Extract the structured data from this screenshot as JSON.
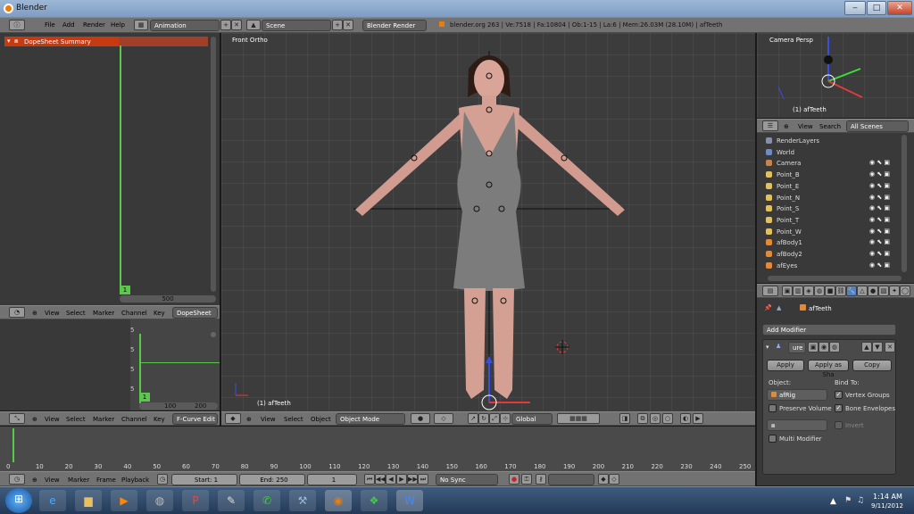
{
  "window": {
    "title": "Blender",
    "minimize": "‒",
    "maximize": "□",
    "close": "✕"
  },
  "menubar": {
    "items": [
      "File",
      "Add",
      "Render",
      "Help"
    ],
    "layout": "Animation",
    "scene": "Scene",
    "engine": "Blender Render",
    "info": "blender.org 263 | Ve:7518 | Fa:10804 | Ob:1-15 | La:6 | Mem:26.03M (28.10M) | afTeeth"
  },
  "dopesheet": {
    "summary": "DopeSheet Summary",
    "frame_marker": "1",
    "scroll_value": "500",
    "header": {
      "menus": [
        "View",
        "Select",
        "Marker",
        "Channel",
        "Key"
      ],
      "mode": "DopeSheet"
    }
  },
  "fcurve": {
    "ticks": [
      "5",
      "5",
      "5",
      "5"
    ],
    "frame_marker": "1",
    "x_labels": [
      "100",
      "200"
    ],
    "header": {
      "menus": [
        "View",
        "Select",
        "Marker",
        "Channel",
        "Key"
      ],
      "mode": "F-Curve Edit"
    }
  },
  "viewport": {
    "label": "Front Ortho",
    "object_label": "(1) afTeeth",
    "header": {
      "menus": [
        "View",
        "Select",
        "Object"
      ],
      "mode": "Object Mode",
      "orientation": "Global"
    }
  },
  "camera_view": {
    "label": "Camera Persp",
    "object_label": "(1) afTeeth"
  },
  "outliner": {
    "header": {
      "view": "View",
      "search": "Search",
      "filter": "All Scenes"
    },
    "rows": [
      {
        "label": "RenderLayers",
        "icon_color": "#8a8fa8"
      },
      {
        "label": "World",
        "icon_color": "#6b8cc9"
      },
      {
        "label": "Camera",
        "icon_color": "#c8824a"
      },
      {
        "label": "Point_B",
        "icon_color": "#e0c060"
      },
      {
        "label": "Point_E",
        "icon_color": "#e0c060"
      },
      {
        "label": "Point_N",
        "icon_color": "#e0c060"
      },
      {
        "label": "Point_S",
        "icon_color": "#e0c060"
      },
      {
        "label": "Point_T",
        "icon_color": "#e0c060"
      },
      {
        "label": "Point_W",
        "icon_color": "#e0c060"
      },
      {
        "label": "afBody1",
        "icon_color": "#e08a3a"
      },
      {
        "label": "afBody2",
        "icon_color": "#e08a3a"
      },
      {
        "label": "afEyes",
        "icon_color": "#e08a3a"
      }
    ]
  },
  "properties": {
    "object_name": "afTeeth",
    "add_modifier": "Add Modifier",
    "modifier_name": "ure",
    "apply": "Apply",
    "apply_shape": "Apply as Sha",
    "copy": "Copy",
    "object_label": "Object:",
    "object_value": "afRig",
    "bind_to": "Bind To:",
    "vertex_groups": "Vertex Groups",
    "preserve_volume": "Preserve Volume",
    "bone_envelopes": "Bone Envelopes",
    "invert": "Invert",
    "multi_modifier": "Multi Modifier"
  },
  "timeline": {
    "ticks": [
      "0",
      "10",
      "20",
      "30",
      "40",
      "50",
      "60",
      "70",
      "80",
      "90",
      "100",
      "110",
      "120",
      "130",
      "140",
      "150",
      "160",
      "170",
      "180",
      "190",
      "200",
      "210",
      "220",
      "230",
      "240",
      "250"
    ],
    "menus": [
      "View",
      "Marker",
      "Frame",
      "Playback"
    ],
    "start": "Start: 1",
    "end": "End: 250",
    "current": "1",
    "sync": "No Sync"
  },
  "taskbar": {
    "time": "1:14 AM",
    "date": "9/11/2012"
  }
}
